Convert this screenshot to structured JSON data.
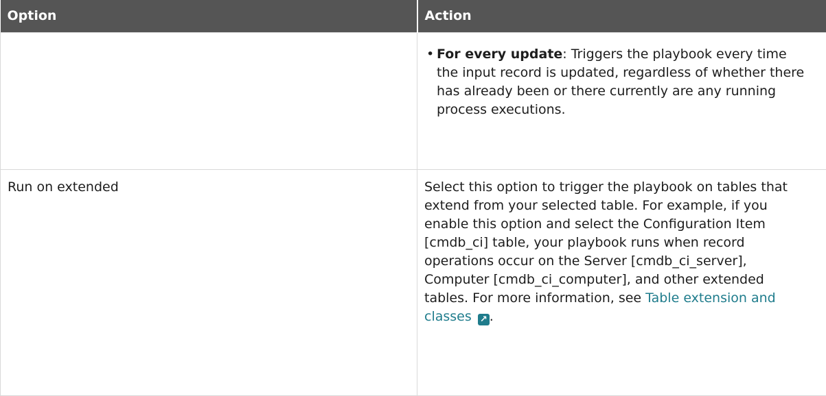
{
  "table": {
    "headers": {
      "option": "Option",
      "action": "Action"
    },
    "rows": [
      {
        "option": "",
        "bullet": {
          "term": "For every update",
          "text": ": Triggers the playbook every time the input record is updated, regardless of whether there has already been or there currently are any running process executions."
        }
      },
      {
        "option": "Run on extended",
        "action_text": "Select this option to trigger the playbook on tables that extend from your selected table. For example, if you enable this option and select the Configuration Item [cmdb_ci] table, your playbook runs when record operations occur on the Server [cmdb_ci_server], Computer [cmdb_ci_computer], and other extended tables. For more information, see ",
        "link_text": "Table extension and classes",
        "link_icon": "external-link-icon",
        "trailing": "."
      }
    ]
  },
  "colors": {
    "header_bg": "#555555",
    "link": "#1f7c8c",
    "border": "#d9d9d9"
  }
}
